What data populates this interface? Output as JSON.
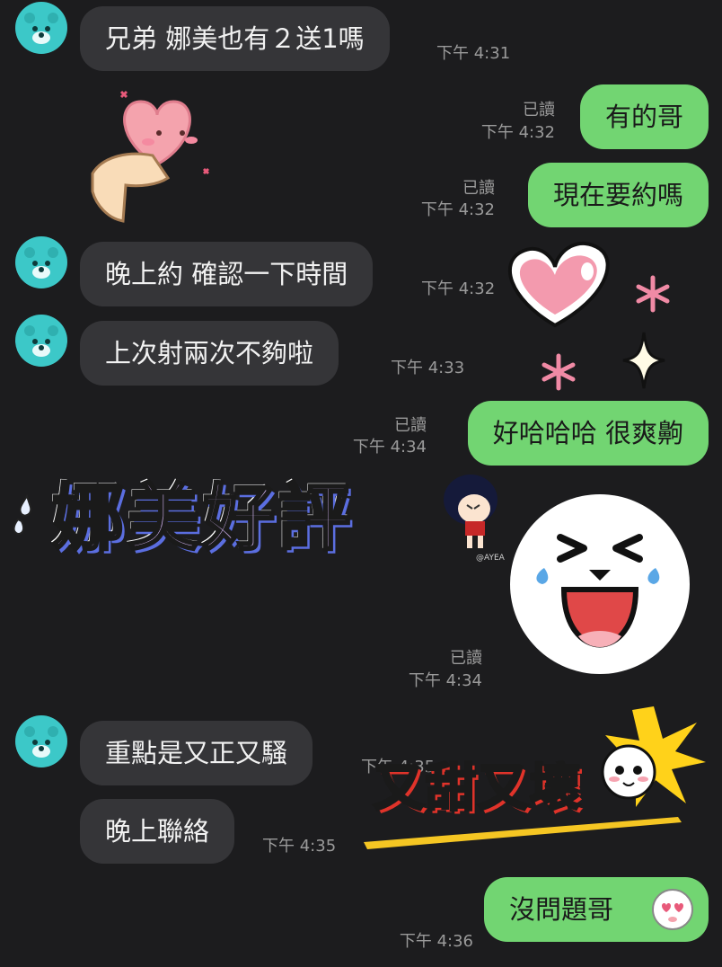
{
  "messages": [
    {
      "id": "m1",
      "side": "in",
      "text": "兄弟 娜美也有２送1嗎",
      "time": "下午 4:31"
    },
    {
      "id": "m2",
      "side": "out",
      "text": "有的哥",
      "read": "已讀",
      "time": "下午 4:32"
    },
    {
      "id": "m3",
      "side": "out",
      "text": "現在要約嗎",
      "read": "已讀",
      "time": "下午 4:32"
    },
    {
      "id": "m4",
      "side": "in",
      "text": "晚上約 確認一下時間",
      "time": "下午 4:32"
    },
    {
      "id": "m5",
      "side": "in",
      "text": "上次射兩次不夠啦",
      "time": "下午 4:33"
    },
    {
      "id": "m6",
      "side": "out",
      "text": "好哈哈哈 很爽齁",
      "read": "已讀",
      "time": "下午 4:34"
    },
    {
      "id": "m7",
      "side": "out",
      "read": "已讀",
      "time": "下午 4:34"
    },
    {
      "id": "m8",
      "side": "in",
      "text": "重點是又正又騷",
      "time": "下午 4:35"
    },
    {
      "id": "m9",
      "side": "in",
      "text": "晚上聯絡",
      "time": "下午 4:35"
    },
    {
      "id": "m10",
      "side": "out",
      "text": "沒問題哥",
      "time": "下午 4:36"
    }
  ],
  "overlays": {
    "nami_title": "娜美好評",
    "sweet_title": "又甜又壞",
    "sticker_credit": "@AYEA"
  },
  "colors": {
    "background": "#1c1c1e",
    "incoming_bubble": "#353538",
    "outgoing_bubble": "#72d572",
    "avatar": "#3cc8c8",
    "meta_text": "#9a9a9a"
  }
}
